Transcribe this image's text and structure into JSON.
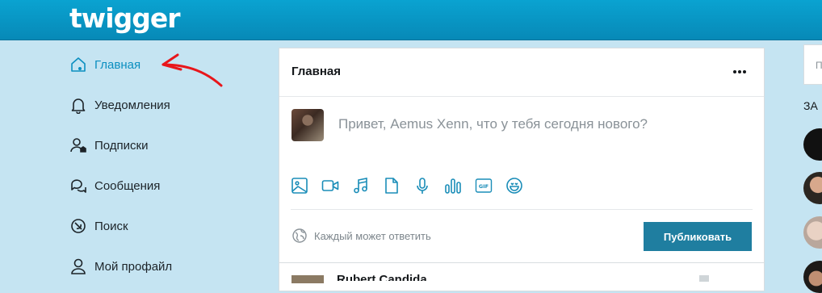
{
  "header": {
    "logo": "twigger"
  },
  "nav": {
    "items": [
      {
        "label": "Главная",
        "icon": "home-icon",
        "active": true
      },
      {
        "label": "Уведомления",
        "icon": "bell-icon"
      },
      {
        "label": "Подписки",
        "icon": "subscriptions-icon"
      },
      {
        "label": "Сообщения",
        "icon": "messages-icon"
      },
      {
        "label": "Поиск",
        "icon": "search-icon"
      },
      {
        "label": "Мой профайл",
        "icon": "profile-icon"
      }
    ]
  },
  "feed": {
    "title": "Главная",
    "composer": {
      "placeholder": "Привет, Aemus Xenn, что у тебя сегодня нового?"
    },
    "tools": [
      "image-icon",
      "video-icon",
      "music-icon",
      "file-icon",
      "microphone-icon",
      "poll-icon",
      "gif-icon",
      "emoji-icon"
    ],
    "reply_setting": "Каждый может ответить",
    "publish_label": "Публиковать",
    "post_author": "Rubert Candida"
  },
  "right": {
    "search_hint": "П",
    "section_title": "ЗА"
  },
  "colors": {
    "accent": "#0b8fc0",
    "button": "#1f7ea0",
    "background": "#c5e4f2",
    "header": "#0aa3d1",
    "annotation_arrow": "#e8161b"
  }
}
